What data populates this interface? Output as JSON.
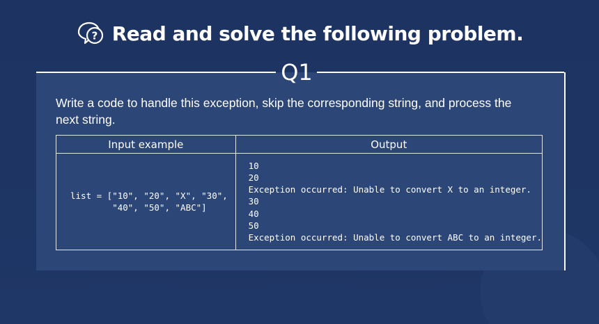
{
  "title": "Read and solve the following problem.",
  "question_label": "Q1",
  "problem_text": "Write a code to handle this exception, skip the corresponding string, and process the next string.",
  "table": {
    "headers": [
      "Input example",
      "Output"
    ],
    "input_code": "list = [\"10\", \"20\", \"X\", \"30\",\n        \"40\", \"50\", \"ABC\"]",
    "output_lines": [
      "10",
      "20",
      "Exception occurred: Unable to convert X to an integer.",
      "30",
      "40",
      "50",
      "Exception occurred: Unable to convert ABC to an integer."
    ]
  },
  "colors": {
    "background": "#1e3462",
    "panel": "#2b4677",
    "text": "#ffffff"
  },
  "icons": [
    "question-chat-icon"
  ]
}
